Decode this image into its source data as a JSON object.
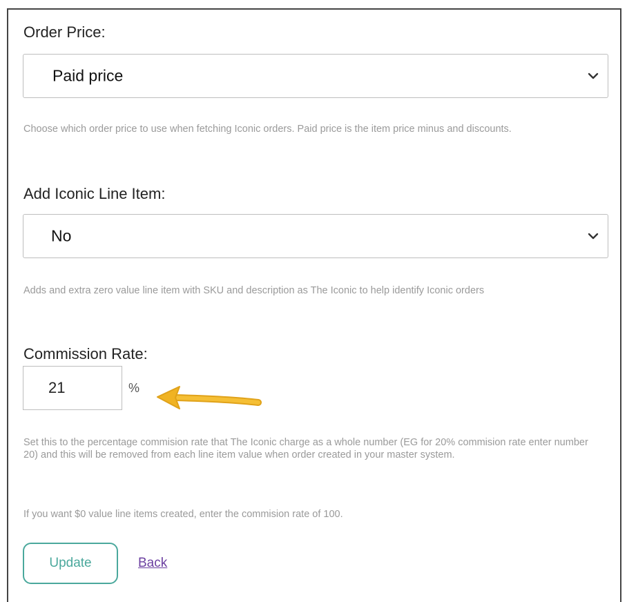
{
  "order_price": {
    "label": "Order Price:",
    "selected": "Paid price",
    "help": "Choose which order price to use when fetching Iconic orders. Paid price is the item price minus and discounts."
  },
  "add_line_item": {
    "label": "Add Iconic Line Item:",
    "selected": "No",
    "help": "Adds and extra zero value line item with SKU and description as The Iconic to help identify Iconic orders"
  },
  "commission_rate": {
    "label": "Commission Rate:",
    "value": "21",
    "unit": "%",
    "help": "Set this to the percentage commision rate that The Iconic charge as a whole number (EG for 20% commision rate enter number 20) and this will be removed from each line item value when order created in your master system.",
    "help2": "If you want $0 value line items created, enter the commision rate of 100."
  },
  "actions": {
    "update_label": "Update",
    "back_label": "Back"
  },
  "colors": {
    "accent": "#4aa89c",
    "link": "#6b3fa0",
    "arrow": "#f0b323",
    "help_text": "#9a9a9a"
  },
  "icons": {
    "select_chevron": "chevron-down-icon",
    "annotation": "arrow-left-icon"
  }
}
